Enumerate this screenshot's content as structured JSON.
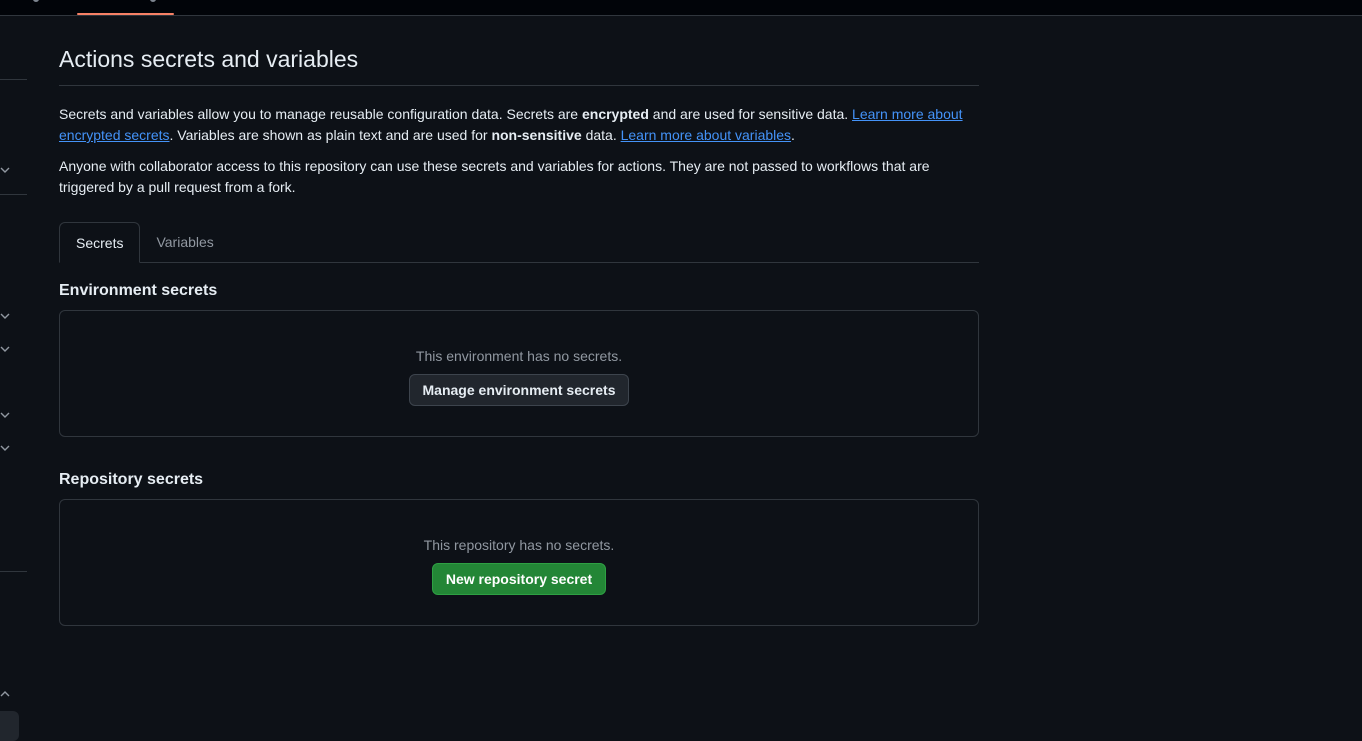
{
  "header": {
    "title": "Actions secrets and variables"
  },
  "intro": {
    "p1_a": "Secrets and variables allow you to manage reusable configuration data. Secrets are ",
    "p1_bold1": "encrypted",
    "p1_b": " and are used for sensitive data. ",
    "p1_link1": "Learn more about encrypted secrets",
    "p1_c": ". Variables are shown as plain text and are used for ",
    "p1_bold2": "non-sensitive",
    "p1_d": " data. ",
    "p1_link2": "Learn more about variables",
    "p1_e": ".",
    "p2": "Anyone with collaborator access to this repository can use these secrets and variables for actions. They are not passed to workflows that are triggered by a pull request from a fork."
  },
  "tabs": [
    {
      "label": "Secrets",
      "selected": true
    },
    {
      "label": "Variables",
      "selected": false
    }
  ],
  "environment": {
    "title": "Environment secrets",
    "empty_text": "This environment has no secrets.",
    "button_label": "Manage environment secrets"
  },
  "repository": {
    "title": "Repository secrets",
    "empty_text": "This repository has no secrets.",
    "button_label": "New repository secret"
  },
  "colors": {
    "background": "#0d1117",
    "border": "#30363d",
    "link": "#4493f8",
    "primary_button": "#238636",
    "tab_accent": "#f78166"
  },
  "icons": {
    "sidebar_chevron": "chevron-down-icon",
    "sidebar_chevron_up": "chevron-up-icon"
  }
}
